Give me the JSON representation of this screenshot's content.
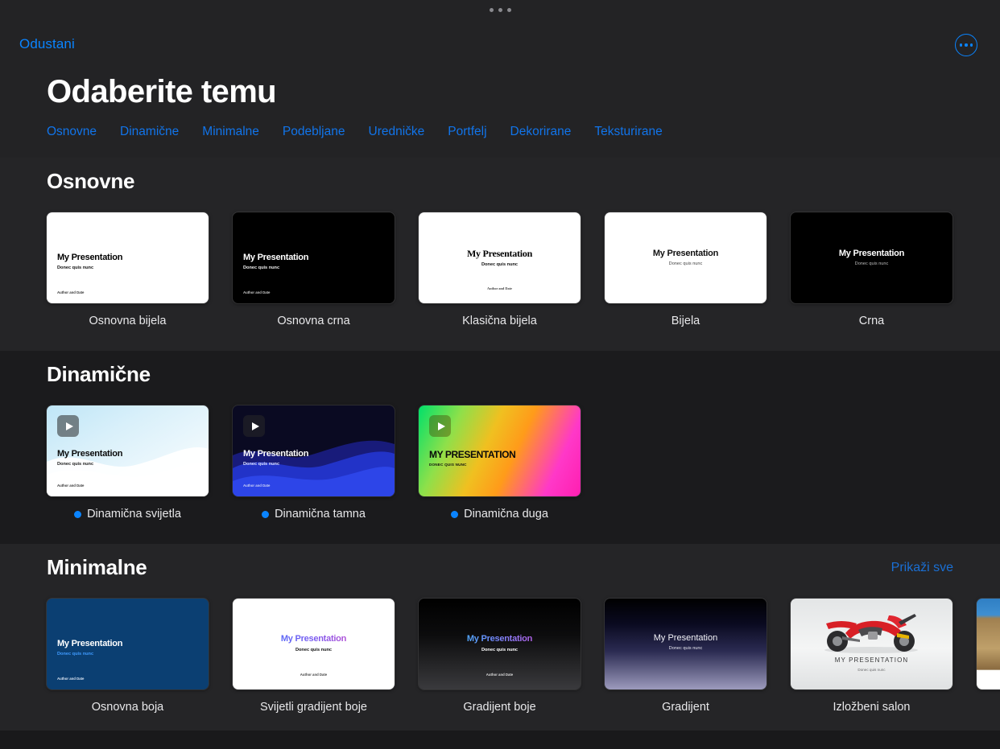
{
  "window": {
    "grabber_icon": "drag-handle-dots"
  },
  "header": {
    "cancel_label": "Odustani",
    "more_icon": "ellipsis-circle-icon",
    "title": "Odaberite temu"
  },
  "tabs": [
    {
      "label": "Osnovne"
    },
    {
      "label": "Dinamične"
    },
    {
      "label": "Minimalne"
    },
    {
      "label": "Podebljane"
    },
    {
      "label": "Uredničke"
    },
    {
      "label": "Portfelj"
    },
    {
      "label": "Dekorirane"
    },
    {
      "label": "Teksturirane"
    }
  ],
  "slide_text": {
    "title": "My Presentation",
    "subtitle": "Donec quis nunc",
    "author": "Author and Date",
    "title_upper": "MY PRESENTATION",
    "subtitle_upper": "DONEC QUIS NUNC"
  },
  "sections": [
    {
      "heading": "Osnovne",
      "show_all_label": "",
      "themes": [
        {
          "name": "Osnovna bijela",
          "animated": false
        },
        {
          "name": "Osnovna crna",
          "animated": false
        },
        {
          "name": "Klasična bijela",
          "animated": false
        },
        {
          "name": "Bijela",
          "animated": false
        },
        {
          "name": "Crna",
          "animated": false
        }
      ]
    },
    {
      "heading": "Dinamične",
      "show_all_label": "",
      "themes": [
        {
          "name": "Dinamična svijetla",
          "animated": true
        },
        {
          "name": "Dinamična tamna",
          "animated": true
        },
        {
          "name": "Dinamična duga",
          "animated": true
        }
      ]
    },
    {
      "heading": "Minimalne",
      "show_all_label": "Prikaži sve",
      "themes": [
        {
          "name": "Osnovna boja",
          "animated": false
        },
        {
          "name": "Svijetli gradijent boje",
          "animated": false
        },
        {
          "name": "Gradijent boje",
          "animated": false
        },
        {
          "name": "Gradijent",
          "animated": false
        },
        {
          "name": "Izložbeni salon",
          "animated": false
        }
      ]
    }
  ],
  "colors": {
    "accent_blue": "#0a84ff",
    "tab_blue": "#1174ea",
    "page_bg": "#1c1c1e",
    "band_light": "#252527",
    "band_dark": "#1b1b1d"
  }
}
